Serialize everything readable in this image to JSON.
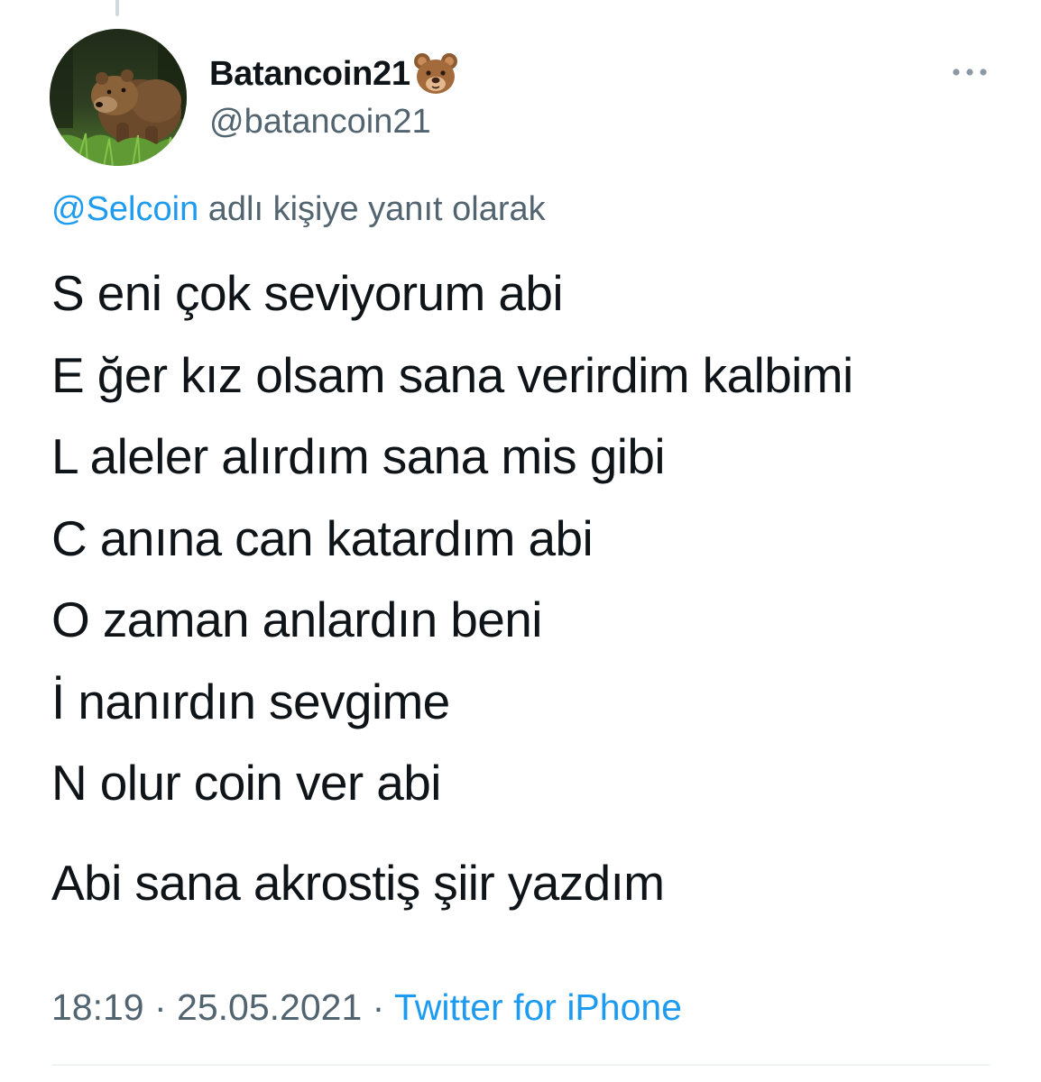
{
  "tweet": {
    "author": {
      "display_name": "Batancoin21",
      "name_emoji": "bear-face-icon",
      "handle": "@batancoin21",
      "avatar": "bear-in-grass-photo"
    },
    "more_icon": "more-horizontal-icon",
    "reply_context": {
      "mention": "@Selcoin",
      "text": " adlı kişiye yanıt olarak"
    },
    "lines": [
      "S eni çok seviyorum abi",
      "E ğer kız olsam sana verirdim kalbimi",
      "L aleler alırdım sana mis gibi",
      "C anına can katardım abi",
      "O zaman anlardın beni",
      "İ nanırdın sevgime",
      "N olur coin ver abi",
      "Abi sana akrostiş şiir yazdım"
    ],
    "meta": {
      "time": "18:19",
      "separator": " · ",
      "date": "25.05.2021",
      "source": "Twitter for iPhone"
    }
  },
  "colors": {
    "text_primary": "#0f1419",
    "text_secondary": "#536471",
    "accent": "#1d9bf0",
    "divider": "#eff3f4"
  }
}
